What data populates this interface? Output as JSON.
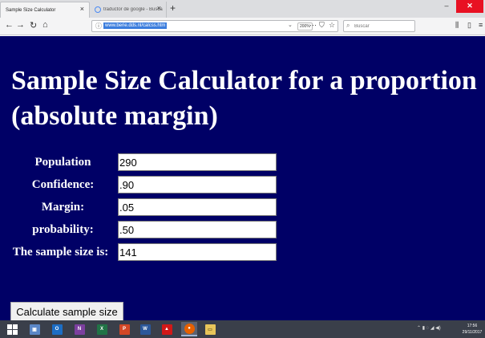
{
  "browser": {
    "tabs": [
      {
        "label": "Sample Size Calculator",
        "active": true
      },
      {
        "label": "traductor de google - Buscar con",
        "active": false
      }
    ],
    "url": "www.berie.dds.nl/calcss.htm",
    "zoom": "200%",
    "search_placeholder": "Buscar"
  },
  "page": {
    "title": "Sample Size Calculator for a proportion (absolute margin)",
    "fields": [
      {
        "label": "Population",
        "value": "290"
      },
      {
        "label": "Confidence:",
        "value": ".90"
      },
      {
        "label": "Margin:",
        "value": ".05"
      },
      {
        "label": "probability:",
        "value": ".50"
      },
      {
        "label": "The sample size is:",
        "value": "141"
      }
    ],
    "calculate_label": "Calculate sample size",
    "background_color": "#000066"
  },
  "taskbar": {
    "apps": [
      "start-icon",
      "file-explorer-icon",
      "outlook-icon",
      "onenote-icon",
      "excel-icon",
      "powerpoint-icon",
      "word-icon",
      "acrobat-icon",
      "firefox-icon",
      "folder-icon"
    ],
    "clock_time": "17:56",
    "clock_date": "29/11/2017"
  }
}
